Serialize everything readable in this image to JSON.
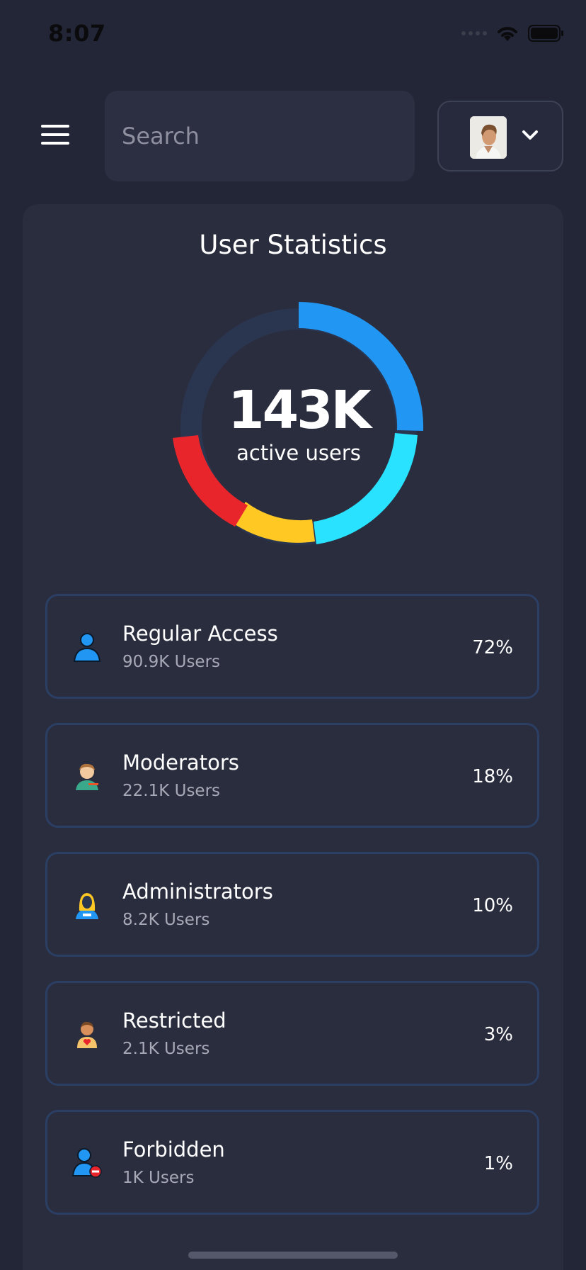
{
  "status_bar": {
    "time": "8:07"
  },
  "search": {
    "placeholder": "Search"
  },
  "stats": {
    "title": "User Statistics",
    "total": "143K",
    "total_label": "active users",
    "items": [
      {
        "name": "Regular Access",
        "count": "90.9K Users",
        "percent": "72%",
        "icon": "user-icon",
        "color": "#2196F3"
      },
      {
        "name": "Moderators",
        "count": "22.1K Users",
        "percent": "18%",
        "icon": "moderator-icon",
        "color": "#29E2FF"
      },
      {
        "name": "Administrators",
        "count": "8.2K Users",
        "percent": "10%",
        "icon": "admin-icon",
        "color": "#FFC823"
      },
      {
        "name": "Restricted",
        "count": "2.1K Users",
        "percent": "3%",
        "icon": "restricted-user-icon",
        "color": "#E8252B"
      },
      {
        "name": "Forbidden",
        "count": "1K Users",
        "percent": "1%",
        "icon": "forbidden-user-icon",
        "color": "#22334F"
      }
    ]
  },
  "colors": {
    "background": "#222637",
    "card": "#2A2D3E",
    "row_border": "#2B3E63",
    "segment_blue": "#2196F3",
    "segment_cyan": "#29E2FF",
    "segment_yellow": "#FFC823",
    "segment_red": "#E8252B",
    "track": "#2A3550"
  }
}
